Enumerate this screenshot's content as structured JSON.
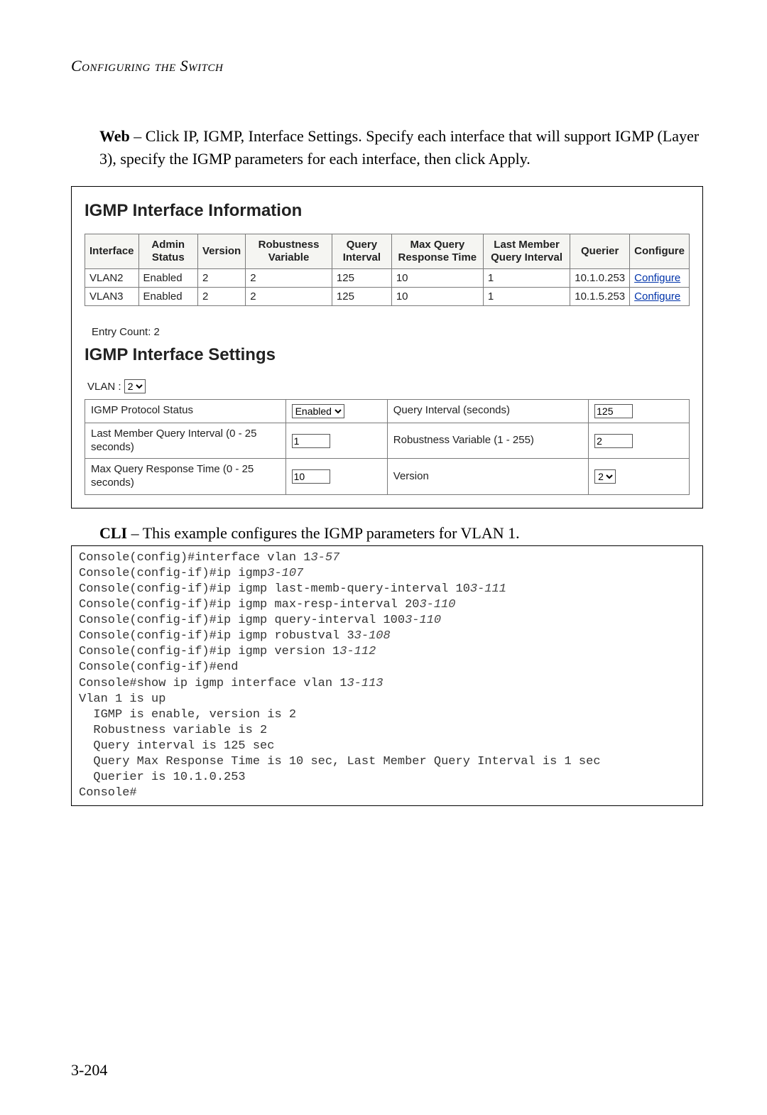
{
  "header": {
    "title": "Configuring the Switch"
  },
  "intro": {
    "prefix": "Web",
    "text": " – Click IP, IGMP, Interface Settings. Specify each interface that will support IGMP (Layer 3), specify the IGMP parameters for each interface, then click Apply."
  },
  "panel": {
    "info_title": "IGMP Interface Information",
    "columns": {
      "interface": "Interface",
      "admin_status": "Admin Status",
      "version": "Version",
      "robustness": "Robustness Variable",
      "query_interval": "Query Interval",
      "max_resp": "Max Query Response Time",
      "last_member": "Last Member Query Interval",
      "querier": "Querier",
      "configure": "Configure"
    },
    "rows": [
      {
        "interface": "VLAN2",
        "admin_status": "Enabled",
        "version": "2",
        "robustness": "2",
        "query_interval": "125",
        "max_resp": "10",
        "last_member": "1",
        "querier": "10.1.0.253",
        "configure": "Configure"
      },
      {
        "interface": "VLAN3",
        "admin_status": "Enabled",
        "version": "2",
        "robustness": "2",
        "query_interval": "125",
        "max_resp": "10",
        "last_member": "1",
        "querier": "10.1.5.253",
        "configure": "Configure"
      }
    ],
    "entry_count_label": "Entry Count: 2",
    "settings_title": "IGMP Interface Settings",
    "vlan_label": "VLAN : ",
    "vlan_value": "2",
    "labels": {
      "protocol_status": "IGMP Protocol Status",
      "query_interval_sec": "Query Interval (seconds)",
      "last_member_interval": "Last Member Query Interval (0 - 25 seconds)",
      "robust_var": "Robustness Variable (1 - 255)",
      "max_resp_time": "Max Query Response Time (0 - 25 seconds)",
      "version": "Version"
    },
    "values": {
      "protocol_status": "Enabled",
      "query_interval_sec": "125",
      "last_member_interval": "1",
      "robust_var": "2",
      "max_resp_time": "10",
      "version": "2"
    }
  },
  "cli_intro": {
    "prefix": "CLI",
    "text": " – This example configures the IGMP parameters for VLAN 1."
  },
  "cli": {
    "lines": [
      {
        "cmd": "Console(config)#interface vlan 1",
        "ref": "3-57"
      },
      {
        "cmd": "Console(config-if)#ip igmp",
        "ref": "3-107"
      },
      {
        "cmd": "Console(config-if)#ip igmp last-memb-query-interval 10",
        "ref": "3-111"
      },
      {
        "cmd": "Console(config-if)#ip igmp max-resp-interval 20",
        "ref": "3-110"
      },
      {
        "cmd": "Console(config-if)#ip igmp query-interval 100",
        "ref": "3-110"
      },
      {
        "cmd": "Console(config-if)#ip igmp robustval 3",
        "ref": "3-108"
      },
      {
        "cmd": "Console(config-if)#ip igmp version 1",
        "ref": "3-112"
      },
      {
        "cmd": "Console(config-if)#end",
        "ref": ""
      },
      {
        "cmd": "Console#show ip igmp interface vlan 1",
        "ref": "3-113"
      },
      {
        "cmd": "Vlan 1 is up",
        "ref": ""
      },
      {
        "cmd": "  IGMP is enable, version is 2",
        "ref": ""
      },
      {
        "cmd": "  Robustness variable is 2",
        "ref": ""
      },
      {
        "cmd": "  Query interval is 125 sec",
        "ref": ""
      },
      {
        "cmd": "  Query Max Response Time is 10 sec, Last Member Query Interval is 1 sec",
        "ref": ""
      },
      {
        "cmd": "  Querier is 10.1.0.253",
        "ref": ""
      },
      {
        "cmd": "Console#",
        "ref": ""
      }
    ]
  },
  "page_number": "3-204"
}
